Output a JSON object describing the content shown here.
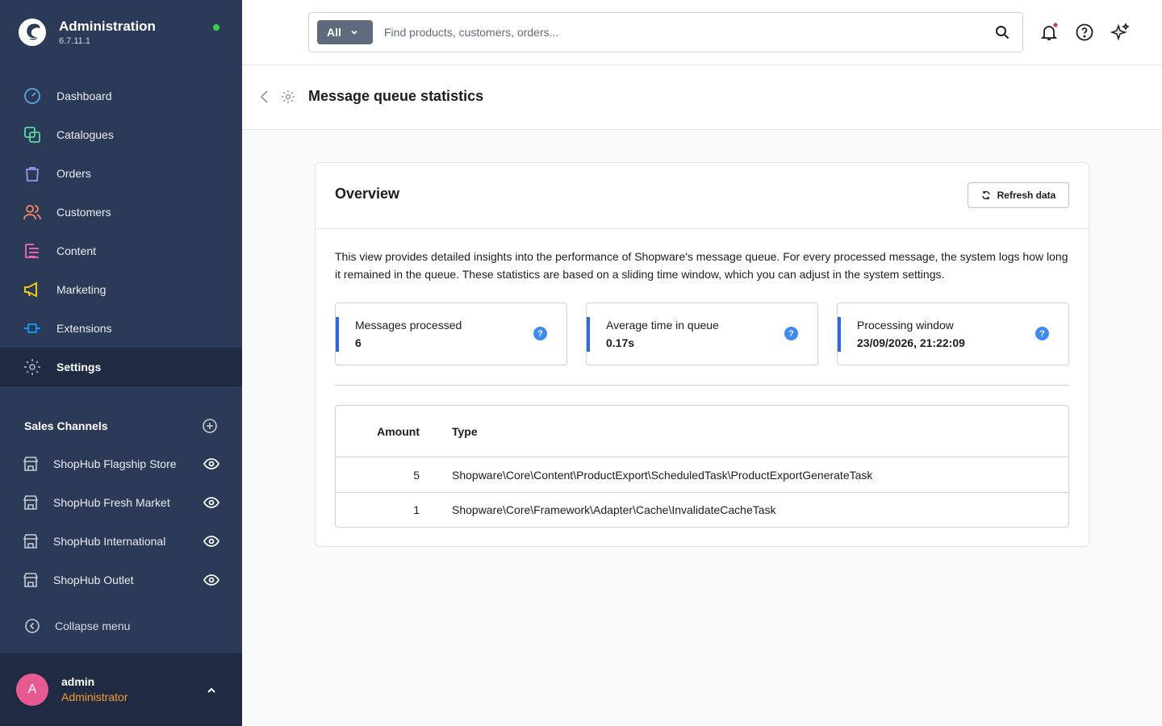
{
  "app": {
    "name": "Administration",
    "version": "6.7.11.1",
    "status_color": "#37d046"
  },
  "nav": {
    "items": [
      {
        "label": "Dashboard",
        "icon": "gauge-icon",
        "color": "#5aa7e8"
      },
      {
        "label": "Catalogues",
        "icon": "catalogue-icon",
        "color": "#57d9a3"
      },
      {
        "label": "Orders",
        "icon": "shopping-bag-icon",
        "color": "#a092f0"
      },
      {
        "label": "Customers",
        "icon": "users-icon",
        "color": "#f88962"
      },
      {
        "label": "Content",
        "icon": "content-icon",
        "color": "#ff68b4"
      },
      {
        "label": "Marketing",
        "icon": "megaphone-icon",
        "color": "#ffd700"
      },
      {
        "label": "Extensions",
        "icon": "plug-icon",
        "color": "#189eff"
      },
      {
        "label": "Settings",
        "icon": "gear-icon",
        "color": "#9aa8b5",
        "active": true
      }
    ]
  },
  "sales_channels": {
    "title": "Sales Channels",
    "items": [
      {
        "label": "ShopHub Flagship Store"
      },
      {
        "label": "ShopHub Fresh Market"
      },
      {
        "label": "ShopHub International"
      },
      {
        "label": "ShopHub Outlet"
      }
    ]
  },
  "collapse_label": "Collapse menu",
  "user": {
    "initial": "A",
    "name": "admin",
    "role": "Administrator"
  },
  "search": {
    "type_label": "All",
    "placeholder": "Find products, customers, orders..."
  },
  "page": {
    "title": "Message queue statistics"
  },
  "overview": {
    "title": "Overview",
    "refresh_label": "Refresh data",
    "description": "This view provides detailed insights into the performance of Shopware's message queue. For every processed message, the system logs how long it remained in the queue. These statistics are based on a sliding time window, which you can adjust in the system settings.",
    "stats": [
      {
        "label": "Messages processed",
        "value": "6"
      },
      {
        "label": "Average time in queue",
        "value": "0.17s"
      },
      {
        "label": "Processing window",
        "value": "23/09/2026, 21:22:09"
      }
    ],
    "help_glyph": "?",
    "table": {
      "headers": {
        "amount": "Amount",
        "type": "Type"
      },
      "rows": [
        {
          "amount": "5",
          "type": "Shopware\\Core\\Content\\ProductExport\\ScheduledTask\\ProductExportGenerateTask"
        },
        {
          "amount": "1",
          "type": "Shopware\\Core\\Framework\\Adapter\\Cache\\InvalidateCacheTask"
        }
      ]
    }
  }
}
